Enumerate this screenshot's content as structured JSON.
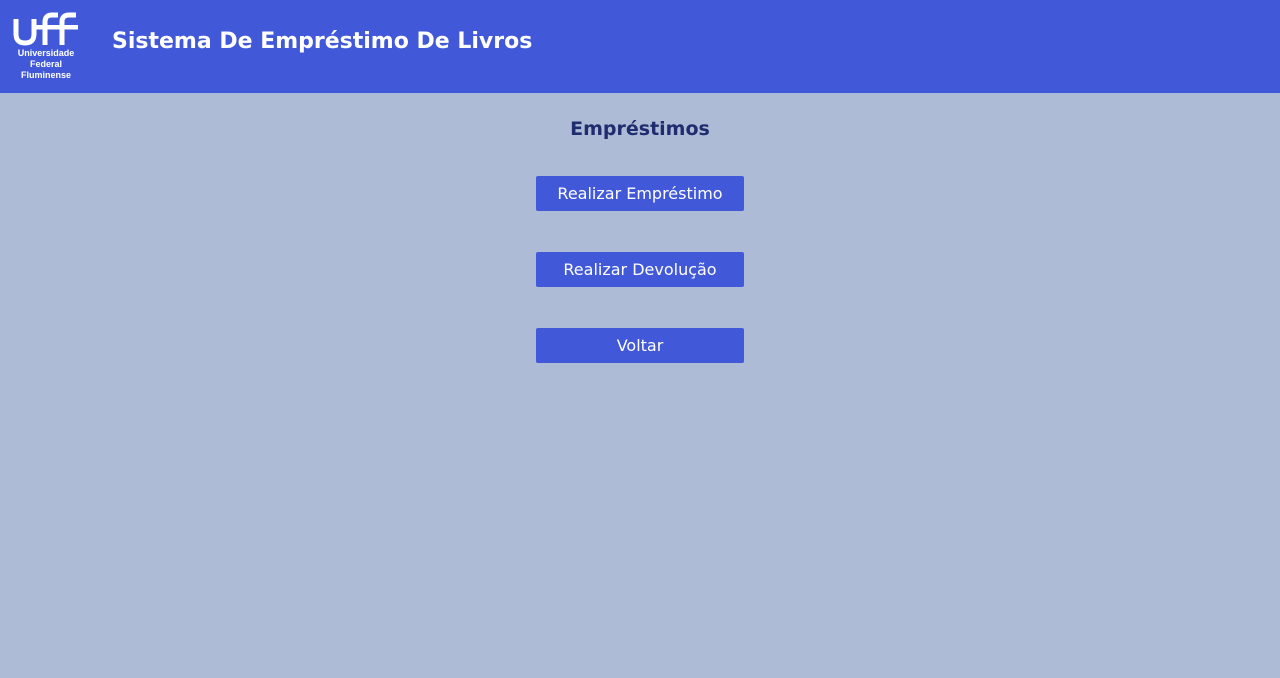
{
  "header": {
    "logo": {
      "mark": "uff",
      "line1": "Universidade",
      "line2": "Federal",
      "line3": "Fluminense"
    },
    "title": "Sistema De Empréstimo De Livros"
  },
  "main": {
    "heading": "Empréstimos",
    "buttons": [
      {
        "label": "Realizar Empréstimo"
      },
      {
        "label": "Realizar Devolução"
      },
      {
        "label": "Voltar"
      }
    ]
  },
  "colors": {
    "header_bg": "#4158d9",
    "page_bg": "#aebbd7",
    "heading_text": "#1f2c6e",
    "button_bg": "#4158d9",
    "button_text": "#ffffff"
  }
}
